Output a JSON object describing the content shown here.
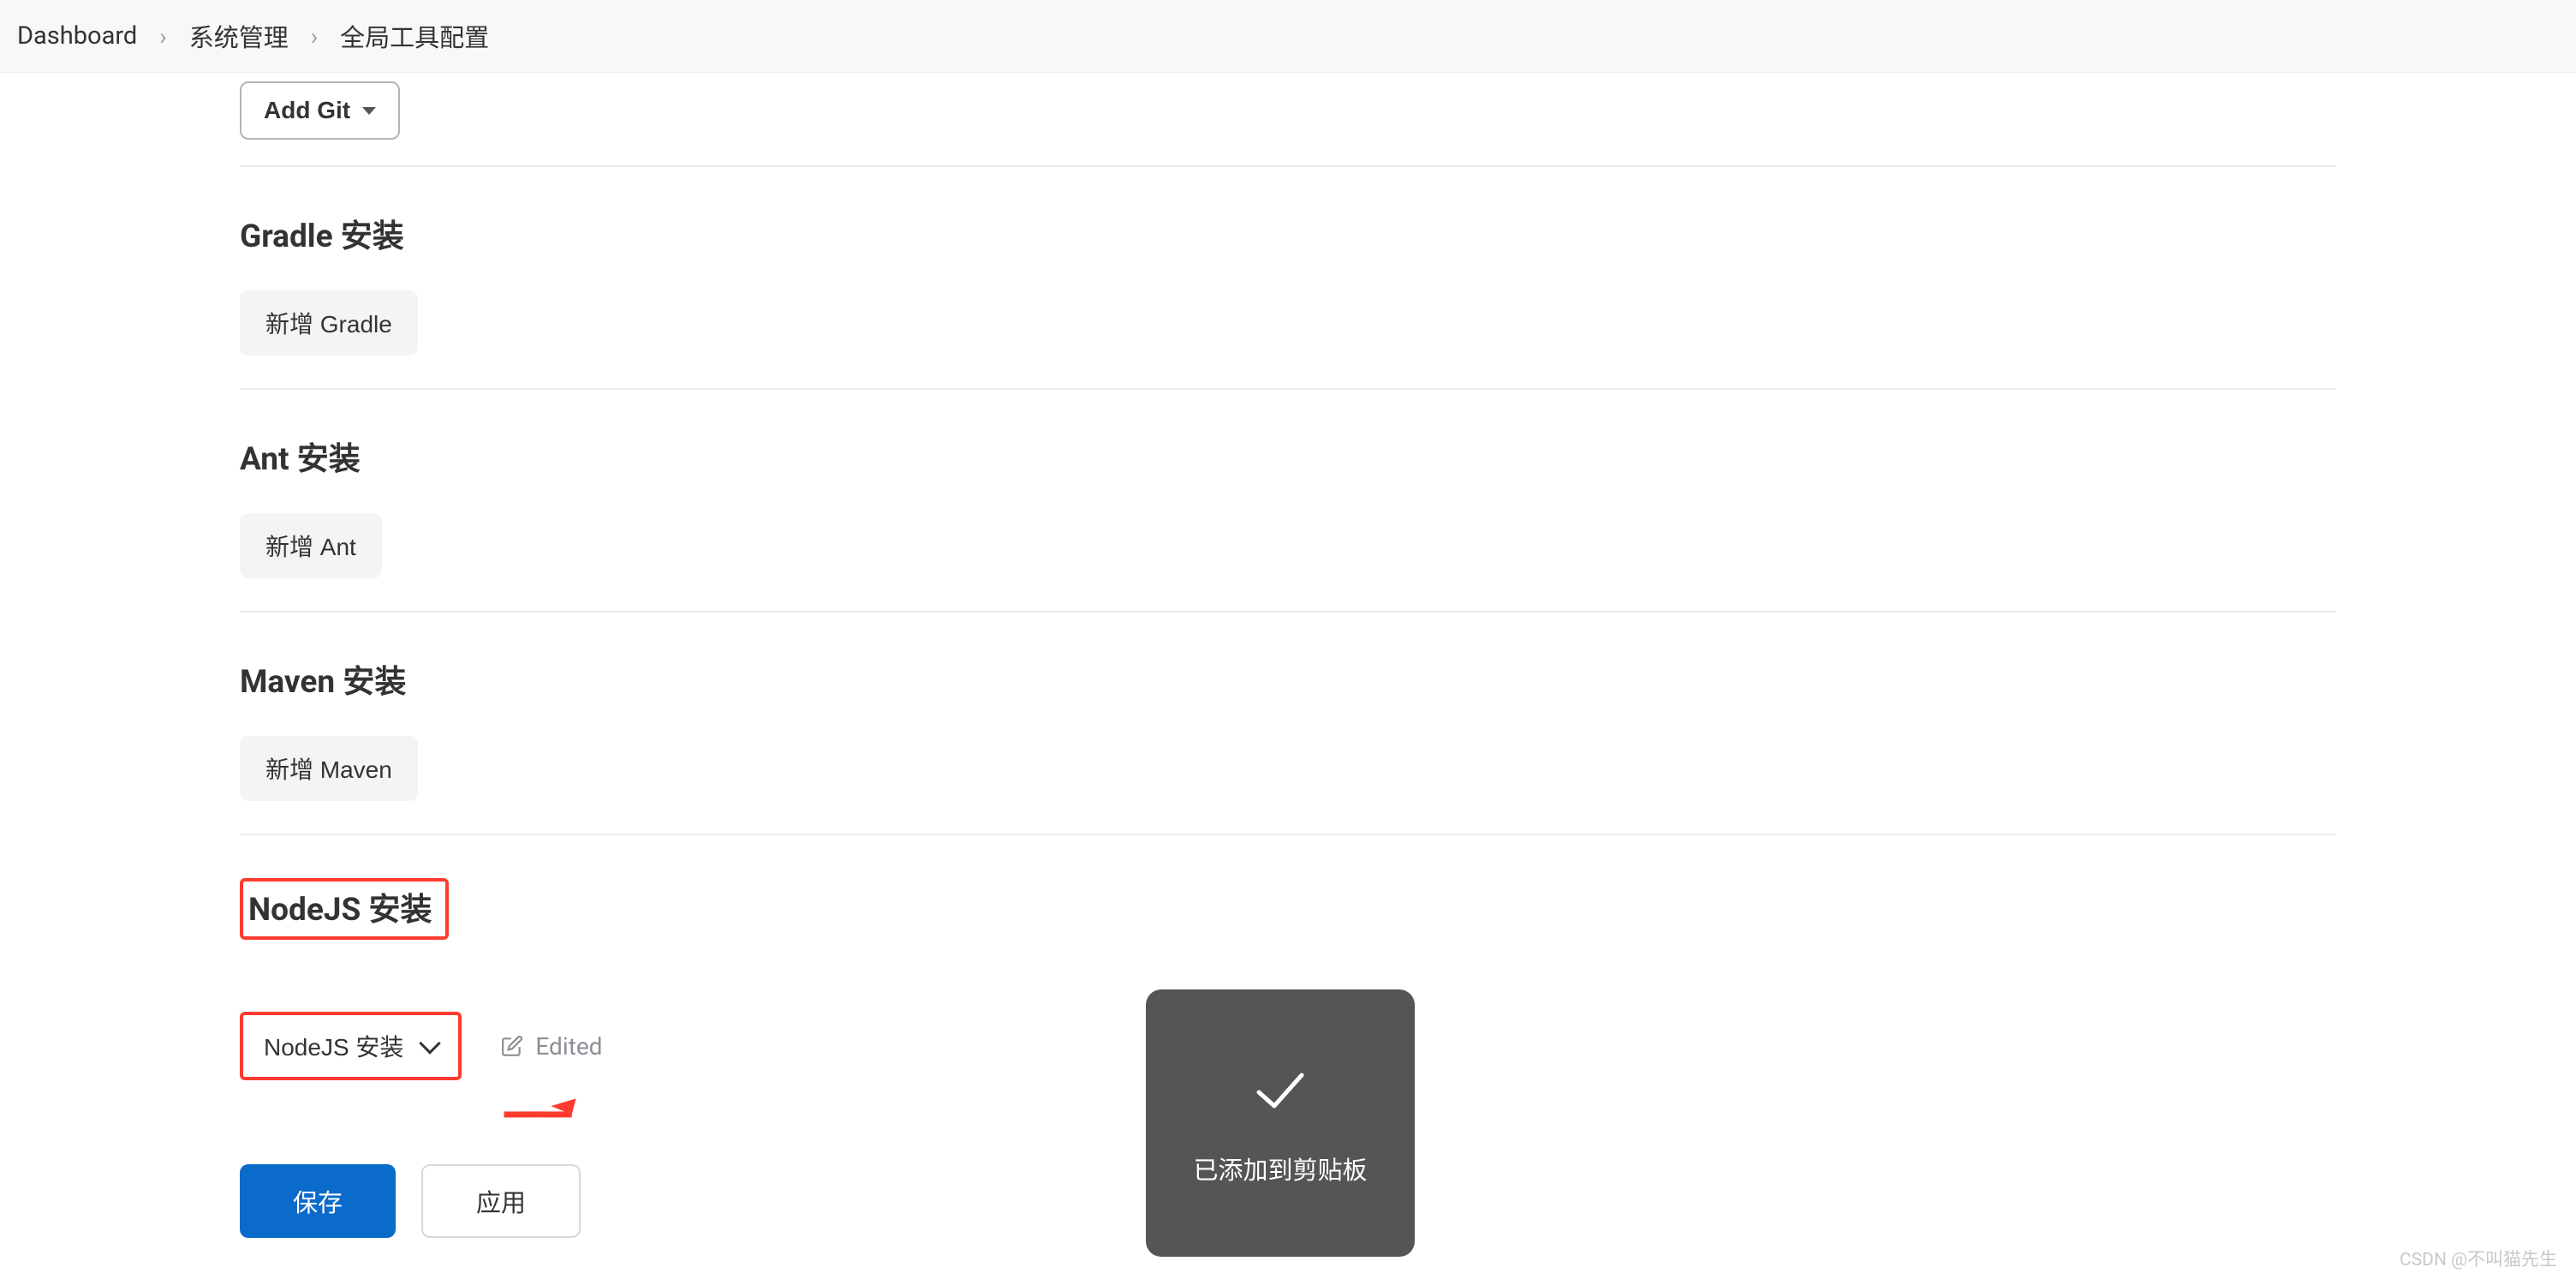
{
  "breadcrumb": {
    "item1": "Dashboard",
    "item2": "系统管理",
    "item3": "全局工具配置"
  },
  "git": {
    "add_button": "Add Git"
  },
  "gradle": {
    "title": "Gradle 安装",
    "add_button": "新增 Gradle"
  },
  "ant": {
    "title": "Ant 安装",
    "add_button": "新增 Ant"
  },
  "maven": {
    "title": "Maven 安装",
    "add_button": "新增 Maven"
  },
  "nodejs": {
    "title": "NodeJS 安装",
    "dropdown_label": "NodeJS 安装",
    "edited_label": "Edited"
  },
  "actions": {
    "save": "保存",
    "apply": "应用"
  },
  "toast": {
    "message": "已添加到剪贴板"
  },
  "watermark": "CSDN @不叫猫先生"
}
